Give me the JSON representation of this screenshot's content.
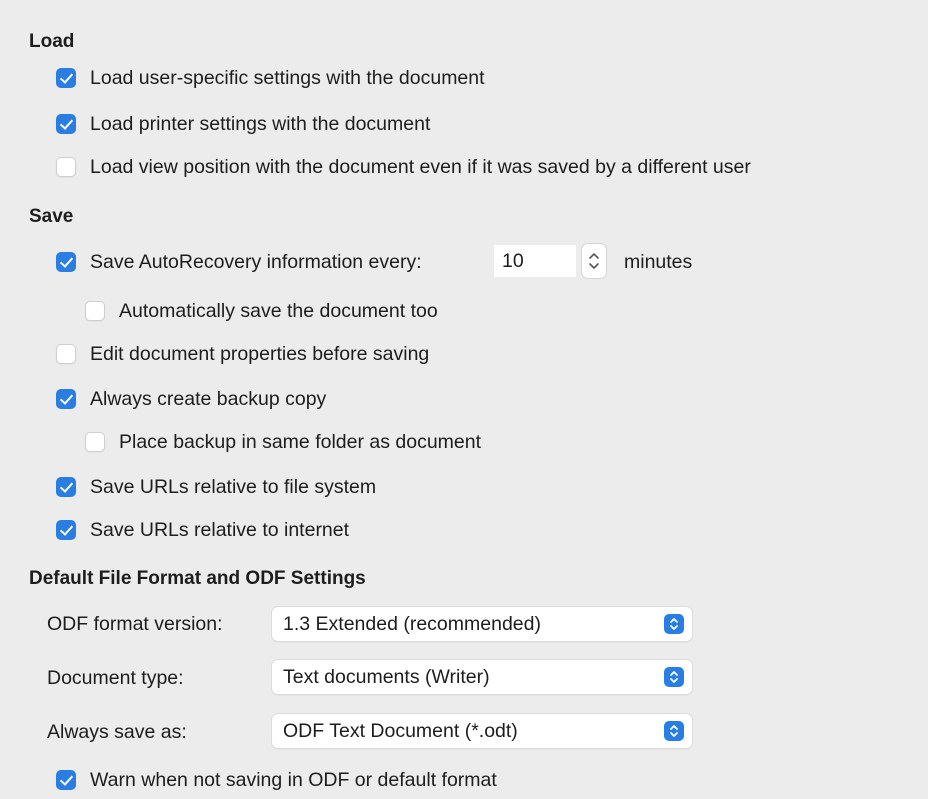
{
  "load": {
    "title": "Load",
    "items": [
      {
        "label": "Load user-specific settings with the document",
        "checked": true
      },
      {
        "label": "Load printer settings with the document",
        "checked": true
      },
      {
        "label": "Load view position with the document even if it was saved by a different user",
        "checked": false
      }
    ]
  },
  "save": {
    "title": "Save",
    "autorecovery": {
      "label": "Save AutoRecovery information every:",
      "checked": true,
      "value": "10",
      "unit": "minutes"
    },
    "auto_save_too": {
      "label": "Automatically save the document too",
      "checked": false
    },
    "edit_properties": {
      "label": "Edit document properties before saving",
      "checked": false
    },
    "backup_copy": {
      "label": "Always create backup copy",
      "checked": true
    },
    "backup_same_folder": {
      "label": "Place backup in same folder as document",
      "checked": false
    },
    "urls_file_system": {
      "label": "Save URLs relative to file system",
      "checked": true
    },
    "urls_internet": {
      "label": "Save URLs relative to internet",
      "checked": true
    }
  },
  "default_format": {
    "title": "Default File Format and ODF Settings",
    "odf_version": {
      "label": "ODF format version:",
      "value": "1.3 Extended (recommended)"
    },
    "document_type": {
      "label": "Document type:",
      "value": "Text documents (Writer)"
    },
    "always_save_as": {
      "label": "Always save as:",
      "value": "ODF Text Document (*.odt)"
    },
    "warn": {
      "label": "Warn when not saving in ODF or default format",
      "checked": true
    }
  },
  "colors": {
    "accent": "#2a7de1",
    "background": "#ececec"
  },
  "icons": {
    "checkbox": "checkmark-icon",
    "stepper": "up-down-chevron-icon",
    "select": "select-arrows-icon"
  }
}
